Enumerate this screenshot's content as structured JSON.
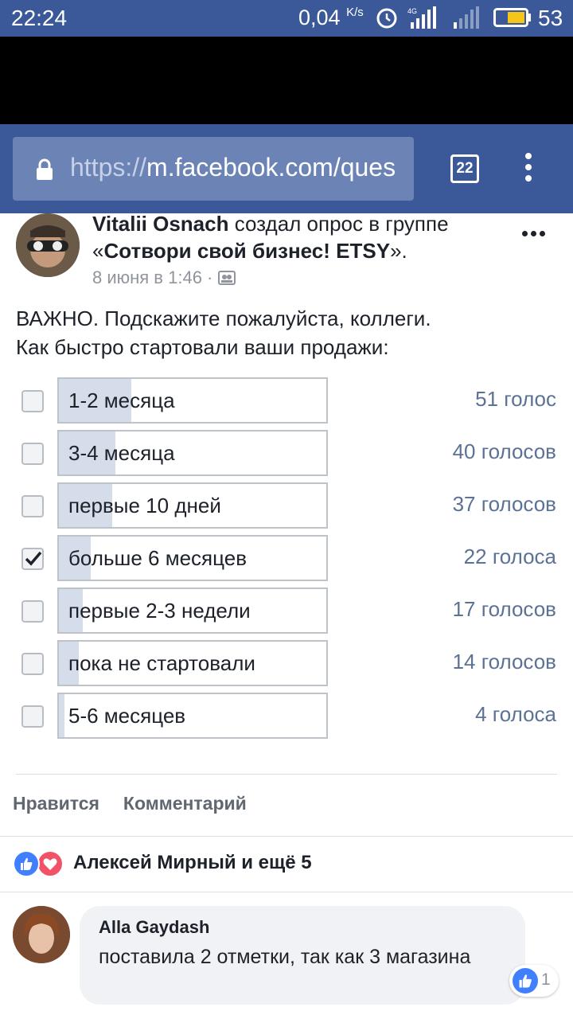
{
  "status_bar": {
    "time": "22:24",
    "net_speed": "0,04",
    "net_speed_unit": "K/s",
    "battery_percent": "53",
    "icons": [
      "alarm-icon",
      "signal-4g-icon",
      "signal-icon",
      "battery-icon"
    ]
  },
  "browser": {
    "url_scheme": "https://",
    "url_rest": "m.facebook.com/ques",
    "tab_count": "22",
    "icons": [
      "lock-icon",
      "tabs-icon",
      "overflow-menu-icon"
    ]
  },
  "post": {
    "author": "Vitalii Osnach",
    "action_text": " создал опрос в группе «",
    "group_name": "Сотвори свой бизнес! ETSY",
    "action_end": "».",
    "timestamp": "8 июня в 1:46 ·",
    "text_line1": "ВАЖНО. Подскажите пожалуйста, коллеги.",
    "text_line2": "Как быстро стартовали ваши продажи:"
  },
  "poll": {
    "options": [
      {
        "label": "1-2 месяца",
        "votes": "51 голос",
        "share": 0.27,
        "checked": false
      },
      {
        "label": "3-4 месяца",
        "votes": "40 голосов",
        "share": 0.21,
        "checked": false
      },
      {
        "label": "первые 10 дней",
        "votes": "37 голосов",
        "share": 0.2,
        "checked": false
      },
      {
        "label": "больше 6 месяцев",
        "votes": "22 голоса",
        "share": 0.12,
        "checked": true
      },
      {
        "label": "первые 2-3 недели",
        "votes": "17 голосов",
        "share": 0.09,
        "checked": false
      },
      {
        "label": "пока не стартовали",
        "votes": "14 голосов",
        "share": 0.075,
        "checked": false
      },
      {
        "label": "5-6 месяцев",
        "votes": "4 голоса",
        "share": 0.02,
        "checked": false
      }
    ]
  },
  "actions": {
    "like": "Нравится",
    "comment": "Комментарий"
  },
  "reactions": {
    "summary": "Алексей Мирный и ещё 5"
  },
  "comment": {
    "author": "Alla Gaydash",
    "text": "поставила 2 отметки, так как 3 магазина",
    "reaction_count": "1"
  },
  "colors": {
    "brand": "#3b5998",
    "url_box": "#6c83b5",
    "poll_fill": "#d4dde9",
    "vote_text": "#5b7294",
    "like_blue": "#4080ff",
    "love_red": "#f25268"
  }
}
